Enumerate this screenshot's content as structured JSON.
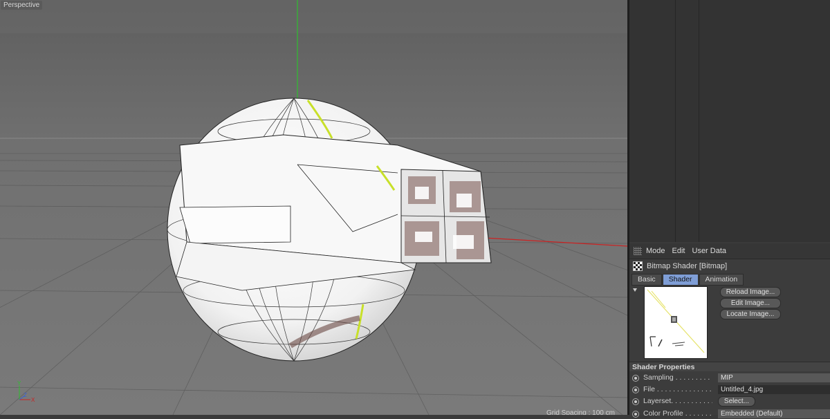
{
  "viewport": {
    "label": "Perspective",
    "grid_spacing": "Grid Spacing : 100 cm",
    "axis": {
      "y": "Y",
      "z": "Z",
      "x": "X"
    }
  },
  "attribute_manager": {
    "menu": [
      "Mode",
      "Edit",
      "User Data"
    ],
    "object_title": "Bitmap Shader [Bitmap]",
    "object_icon": "bitmap-checker-icon",
    "tabs": [
      {
        "label": "Basic",
        "active": false
      },
      {
        "label": "Shader",
        "active": true
      },
      {
        "label": "Animation",
        "active": false
      }
    ],
    "buttons": {
      "reload": "Reload Image...",
      "edit": "Edit Image...",
      "locate": "Locate Image..."
    },
    "section_title": "Shader Properties",
    "properties": [
      {
        "label": "Sampling",
        "dots": " . . . . . . . . . . . .",
        "value": "MIP",
        "kind": "dropdown"
      },
      {
        "label": "File",
        "dots": " . . . . . . . . . . . . . . . .",
        "value": "Untitled_4.jpg",
        "kind": "field"
      },
      {
        "label": "Layerset",
        "dots": ". . . . . . . . . . . .",
        "value": "Select...",
        "kind": "button"
      },
      {
        "label": "Color Profile",
        "dots": " . . . . . . . .",
        "value": "Embedded (Default)",
        "kind": "dropdown"
      }
    ]
  },
  "colors": {
    "viewport_bg": "#6b6b6b",
    "accent_tab": "#7f9ed6",
    "axis_y": "#2fbf2f",
    "axis_x": "#cc2222"
  }
}
